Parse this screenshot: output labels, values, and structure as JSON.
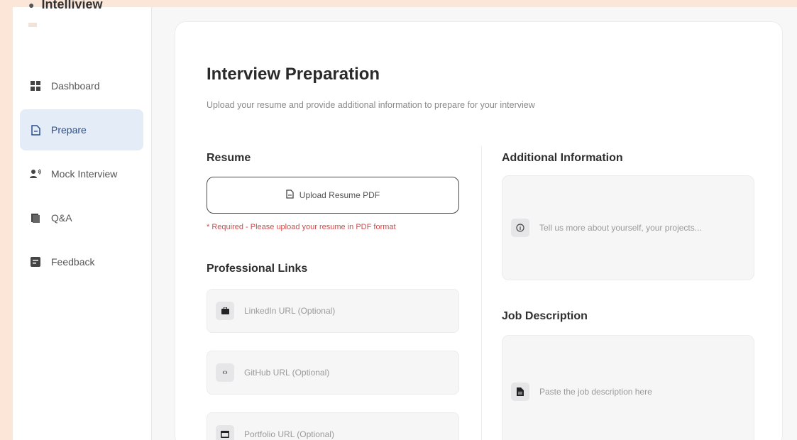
{
  "brand": {
    "name": "Intelliview"
  },
  "sidebar": {
    "items": [
      {
        "label": "Dashboard",
        "icon": "dashboard-icon"
      },
      {
        "label": "Prepare",
        "icon": "document-icon",
        "active": true
      },
      {
        "label": "Mock Interview",
        "icon": "people-icon"
      },
      {
        "label": "Q&A",
        "icon": "book-icon"
      },
      {
        "label": "Feedback",
        "icon": "feedback-icon"
      }
    ]
  },
  "main": {
    "title": "Interview Preparation",
    "subtitle": "Upload your resume and provide additional information to prepare for your interview",
    "resume": {
      "heading": "Resume",
      "upload_label": "Upload Resume PDF",
      "required_note": "* Required - Please upload your resume in PDF format"
    },
    "links": {
      "heading": "Professional Links",
      "linkedin_placeholder": "LinkedIn URL (Optional)",
      "github_placeholder": "GitHub URL (Optional)",
      "portfolio_placeholder": "Portfolio URL (Optional)"
    },
    "additional": {
      "heading": "Additional Information",
      "placeholder": "Tell us more about yourself, your projects..."
    },
    "job": {
      "heading": "Job Description",
      "placeholder": "Paste the job description here"
    }
  },
  "colors": {
    "page_bg": "#fbe6d8",
    "active_nav_bg": "#e4ecf7",
    "required_red": "#d24a4a"
  }
}
